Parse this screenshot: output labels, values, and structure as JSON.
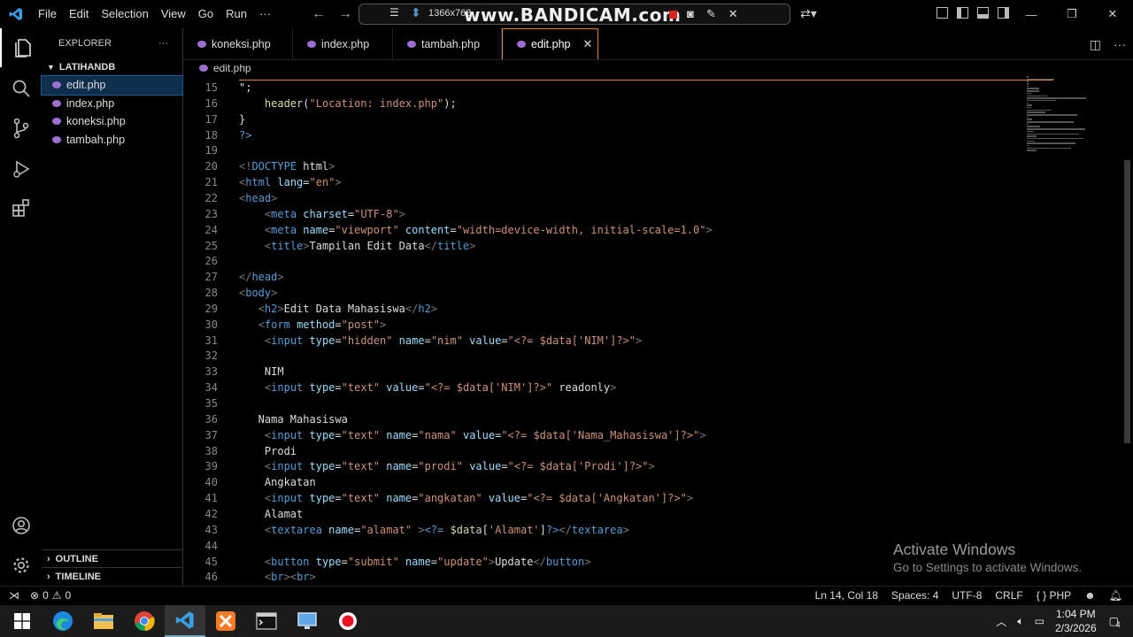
{
  "menu": [
    "File",
    "Edit",
    "Selection",
    "View",
    "Go",
    "Run",
    "···"
  ],
  "recorder": {
    "resolution": "1366x768",
    "watermark": "www.BANDICAM.com"
  },
  "sidebar": {
    "title": "EXPLORER",
    "folder": "LATIHANDB",
    "files": [
      "edit.php",
      "index.php",
      "koneksi.php",
      "tambah.php"
    ],
    "outline": "OUTLINE",
    "timeline": "TIMELINE"
  },
  "tabs": [
    "koneksi.php",
    "index.php",
    "tambah.php",
    "edit.php"
  ],
  "breadcrumb": "edit.php",
  "code_lines": [
    {
      "n": "15",
      "t": "\";"
    },
    {
      "n": "16",
      "t": "    header(\"Location: index.php\");"
    },
    {
      "n": "17",
      "t": "}"
    },
    {
      "n": "18",
      "t": "?>"
    },
    {
      "n": "19",
      "t": ""
    },
    {
      "n": "20",
      "t": "<!DOCTYPE html>"
    },
    {
      "n": "21",
      "t": "<html lang=\"en\">"
    },
    {
      "n": "22",
      "t": "<head>"
    },
    {
      "n": "23",
      "t": "    <meta charset=\"UTF-8\">"
    },
    {
      "n": "24",
      "t": "    <meta name=\"viewport\" content=\"width=device-width, initial-scale=1.0\">"
    },
    {
      "n": "25",
      "t": "    <title>Tampilan Edit Data</title>"
    },
    {
      "n": "26",
      "t": ""
    },
    {
      "n": "27",
      "t": "</head>"
    },
    {
      "n": "28",
      "t": "<body>"
    },
    {
      "n": "29",
      "t": "   <h2>Edit Data Mahasiswa</h2>"
    },
    {
      "n": "30",
      "t": "   <form method=\"post\">"
    },
    {
      "n": "31",
      "t": "    <input type=\"hidden\" name=\"nim\" value=\"<?= $data['NIM']?>\">"
    },
    {
      "n": "32",
      "t": ""
    },
    {
      "n": "33",
      "t": "    NIM"
    },
    {
      "n": "34",
      "t": "    <input type=\"text\" value=\"<?= $data['NIM']?>\" readonly>"
    },
    {
      "n": "35",
      "t": ""
    },
    {
      "n": "36",
      "t": "   Nama Mahasiswa"
    },
    {
      "n": "37",
      "t": "    <input type=\"text\" name=\"nama\" value=\"<?= $data['Nama_Mahasiswa']?>\">"
    },
    {
      "n": "38",
      "t": "    Prodi"
    },
    {
      "n": "39",
      "t": "    <input type=\"text\" name=\"prodi\" value=\"<?= $data['Prodi']?>\">"
    },
    {
      "n": "40",
      "t": "    Angkatan"
    },
    {
      "n": "41",
      "t": "    <input type=\"text\" name=\"angkatan\" value=\"<?= $data['Angkatan']?>\">"
    },
    {
      "n": "42",
      "t": "    Alamat"
    },
    {
      "n": "43",
      "t": "    <textarea name=\"alamat\" ><?= $data['Alamat']?></textarea>"
    },
    {
      "n": "44",
      "t": ""
    },
    {
      "n": "45",
      "t": "    <button type=\"submit\" name=\"update\">Update</button>"
    },
    {
      "n": "46",
      "t": "    <br><br>"
    }
  ],
  "activate_windows": {
    "title": "Activate Windows",
    "subtitle": "Go to Settings to activate Windows."
  },
  "status": {
    "errors": "0",
    "warnings": "0",
    "position": "Ln 14, Col 18",
    "spaces": "Spaces: 4",
    "encoding": "UTF-8",
    "eol": "CRLF",
    "language": "PHP"
  },
  "taskbar": {
    "time": "1:04 PM",
    "date": "2/3/2026",
    "notifications": "4"
  },
  "colors": {
    "accent": "#3b9de3",
    "tab_border": "#cc8844",
    "php_icon": "#9c6fd0"
  }
}
